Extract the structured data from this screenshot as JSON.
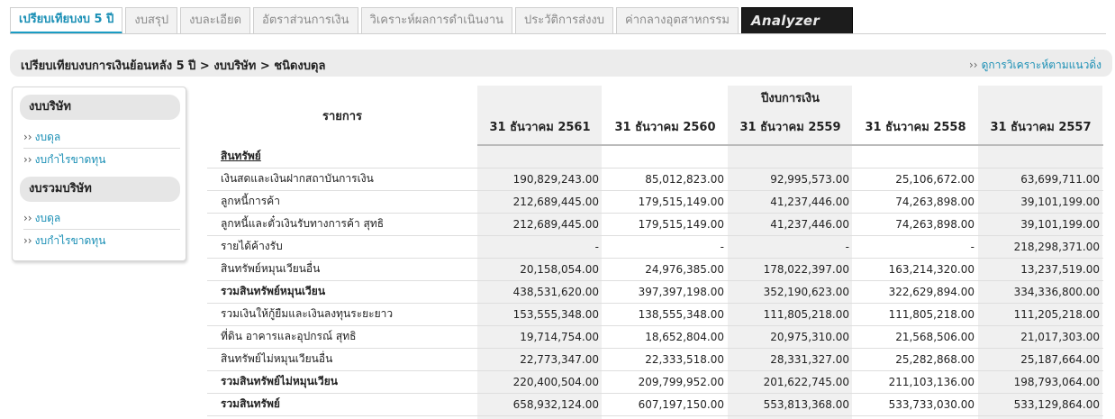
{
  "tabs": [
    {
      "label": "เปรียบเทียบงบ 5 ปี",
      "active": true
    },
    {
      "label": "งบสรุป",
      "active": false
    },
    {
      "label": "งบละเอียด",
      "active": false
    },
    {
      "label": "อัตราส่วนการเงิน",
      "active": false
    },
    {
      "label": "วิเคราะห์ผลการดำเนินงาน",
      "active": false
    },
    {
      "label": "ประวัติการส่งงบ",
      "active": false
    },
    {
      "label": "ค่ากลางอุตสาหกรรม",
      "active": false
    },
    {
      "label": "Analyzer",
      "active": false
    }
  ],
  "breadcrumb": "เปรียบเทียบงบการเงินย้อนหลัง 5 ปี > งบบริษัท > ชนิดงบดุล",
  "trend_link": {
    "arrows": "››",
    "label": "ดูการวิเคราะห์ตามแนวดิ่ง"
  },
  "sidebar": {
    "company": {
      "title": "งบบริษัท",
      "links": [
        {
          "arrows": "››",
          "label": "งบดุล"
        },
        {
          "arrows": "››",
          "label": "งบกำไรขาดทุน"
        }
      ]
    },
    "consolidated": {
      "title": "งบรวมบริษัท",
      "links": [
        {
          "arrows": "››",
          "label": "งบดุล"
        },
        {
          "arrows": "››",
          "label": "งบกำไรขาดทุน"
        }
      ]
    }
  },
  "table": {
    "item_header": "รายการ",
    "fiscal_year_header": "ปีงบการเงิน",
    "years": [
      "31 ธันวาคม 2561",
      "31 ธันวาคม 2560",
      "31 ธันวาคม 2559",
      "31 ธันวาคม 2558",
      "31 ธันวาคม 2557"
    ],
    "section_title": "สินทรัพย์",
    "rows": [
      {
        "label": "เงินสดและเงินฝากสถาบันการเงิน",
        "values": [
          "190,829,243.00",
          "85,012,823.00",
          "92,995,573.00",
          "25,106,672.00",
          "63,699,711.00"
        ],
        "bold": false
      },
      {
        "label": "ลูกหนี้การค้า",
        "values": [
          "212,689,445.00",
          "179,515,149.00",
          "41,237,446.00",
          "74,263,898.00",
          "39,101,199.00"
        ],
        "bold": false
      },
      {
        "label": "ลูกหนี้และตั๋วเงินรับทางการค้า สุทธิ",
        "values": [
          "212,689,445.00",
          "179,515,149.00",
          "41,237,446.00",
          "74,263,898.00",
          "39,101,199.00"
        ],
        "bold": false
      },
      {
        "label": "รายได้ค้างรับ",
        "values": [
          "-",
          "-",
          "-",
          "-",
          "218,298,371.00"
        ],
        "bold": false
      },
      {
        "label": "สินทรัพย์หมุนเวียนอื่น",
        "values": [
          "20,158,054.00",
          "24,976,385.00",
          "178,022,397.00",
          "163,214,320.00",
          "13,237,519.00"
        ],
        "bold": false
      },
      {
        "label": "รวมสินทรัพย์หมุนเวียน",
        "values": [
          "438,531,620.00",
          "397,397,198.00",
          "352,190,623.00",
          "322,629,894.00",
          "334,336,800.00"
        ],
        "bold": true
      },
      {
        "label": "รวมเงินให้กู้ยืมและเงินลงทุนระยะยาว",
        "values": [
          "153,555,348.00",
          "138,555,348.00",
          "111,805,218.00",
          "111,805,218.00",
          "111,205,218.00"
        ],
        "bold": false
      },
      {
        "label": "ที่ดิน อาคารและอุปกรณ์ สุทธิ",
        "values": [
          "19,714,754.00",
          "18,652,804.00",
          "20,975,310.00",
          "21,568,506.00",
          "21,017,303.00"
        ],
        "bold": false
      },
      {
        "label": "สินทรัพย์ไม่หมุนเวียนอื่น",
        "values": [
          "22,773,347.00",
          "22,333,518.00",
          "28,331,327.00",
          "25,282,868.00",
          "25,187,664.00"
        ],
        "bold": false
      },
      {
        "label": "รวมสินทรัพย์ไม่หมุนเวียน",
        "values": [
          "220,400,504.00",
          "209,799,952.00",
          "201,622,745.00",
          "211,103,136.00",
          "198,793,064.00"
        ],
        "bold": true
      },
      {
        "label": "รวมสินทรัพย์",
        "values": [
          "658,932,124.00",
          "607,197,150.00",
          "553,813,368.00",
          "533,733,030.00",
          "533,129,864.00"
        ],
        "bold": true
      }
    ]
  }
}
